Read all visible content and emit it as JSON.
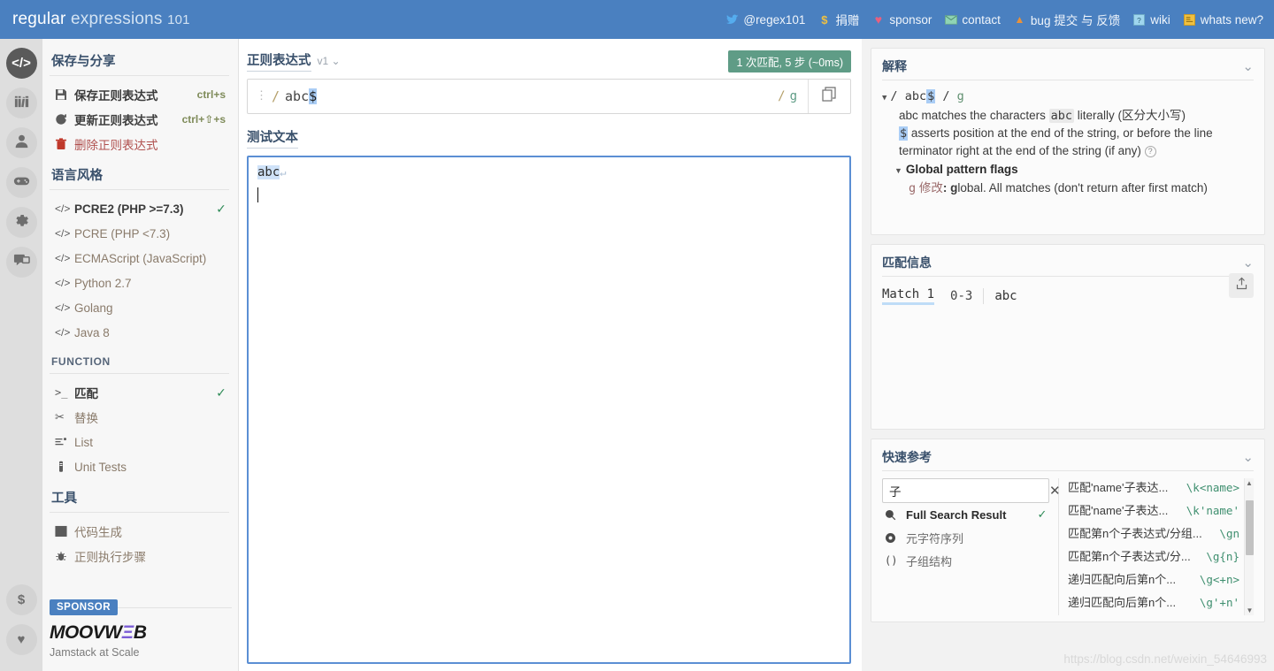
{
  "header": {
    "logo_regular": "regular ",
    "logo_expressions": "expressions ",
    "logo_101": "101",
    "nav": [
      {
        "icon": "twitter-icon",
        "glyph": "🐦",
        "label": "@regex101",
        "color": "#55acee"
      },
      {
        "icon": "dollar-icon",
        "glyph": "$",
        "label": "捐赠",
        "color": "#f0c040"
      },
      {
        "icon": "heart-icon",
        "glyph": "♥",
        "label": "sponsor",
        "color": "#e8607f"
      },
      {
        "icon": "envelope-icon",
        "glyph": "✉",
        "label": "contact",
        "color": "#7fc7a8"
      },
      {
        "icon": "warning-triangle-icon",
        "glyph": "▲",
        "label": "bug 提交 与 反馈",
        "color": "#e8913a"
      },
      {
        "icon": "wiki-icon",
        "glyph": "?",
        "label": "wiki",
        "color": "#7fc7e8"
      },
      {
        "icon": "news-page-icon",
        "glyph": "▤",
        "label": "whats new?",
        "color": "#f0c040"
      }
    ]
  },
  "rail": {
    "items": [
      {
        "name": "code-icon",
        "active": true
      },
      {
        "name": "library-icon",
        "active": false
      },
      {
        "name": "account-icon",
        "active": false
      },
      {
        "name": "gamepad-icon",
        "active": false
      },
      {
        "name": "gear-icon",
        "active": false
      },
      {
        "name": "chat-icon",
        "active": false
      }
    ],
    "bottom": [
      {
        "name": "dollar-icon",
        "glyph": "$"
      },
      {
        "name": "heart-icon",
        "glyph": "♥"
      }
    ]
  },
  "sidebar": {
    "save_share_title": "保存与分享",
    "save_share_items": [
      {
        "icon": "save-disk-icon",
        "label": "保存正则表达式",
        "shortcut": "ctrl+s"
      },
      {
        "icon": "refresh-icon",
        "label": "更新正则表达式",
        "shortcut": "ctrl+⇧+s"
      },
      {
        "icon": "trash-icon",
        "label": "删除正则表达式",
        "shortcut": ""
      }
    ],
    "flavor_title": "语言风格",
    "flavors": [
      {
        "label": "PCRE2 (PHP >=7.3)",
        "selected": true
      },
      {
        "label": "PCRE (PHP <7.3)",
        "selected": false
      },
      {
        "label": "ECMAScript (JavaScript)",
        "selected": false
      },
      {
        "label": "Python 2.7",
        "selected": false
      },
      {
        "label": "Golang",
        "selected": false
      },
      {
        "label": "Java 8",
        "selected": false
      }
    ],
    "function_title": "FUNCTION",
    "functions": [
      {
        "icon": "terminal-icon",
        "label": "匹配",
        "selected": true
      },
      {
        "icon": "scissors-icon",
        "label": "替换",
        "selected": false
      },
      {
        "icon": "list-icon",
        "label": "List",
        "selected": false
      },
      {
        "icon": "testtube-icon",
        "label": "Unit Tests",
        "selected": false
      }
    ],
    "tools_title": "工具",
    "tools": [
      {
        "icon": "code-gen-icon",
        "label": "代码生成"
      },
      {
        "icon": "debugger-bug-icon",
        "label": "正则执行步骤"
      }
    ],
    "sponsor_badge": "SPONSOR",
    "sponsor_name_a": "MOOVW",
    "sponsor_name_e": "Ξ",
    "sponsor_name_b": "B",
    "sponsor_tagline": "Jamstack at Scale"
  },
  "regex": {
    "title": "正则表达式",
    "version": "v1",
    "match_badge": "1 次匹配, 5 步 (~0ms)",
    "open_slash": "/",
    "pattern_literal": "abc",
    "pattern_selected": "$",
    "close_slash": "/",
    "flags": "g",
    "copy_icon": "copy-icon",
    "options_icon": "more-options-icon"
  },
  "test_string": {
    "title": "测试文本",
    "highlighted_text": "abc",
    "newline_glyph": "↵",
    "second_line": ""
  },
  "explanation": {
    "title": "解释",
    "root_slash_open": "/",
    "root_literal": "abc",
    "root_selected": "$",
    "root_slash_close": "/",
    "root_flags": "g",
    "line1_prefix": "abc",
    "line1_mid": " matches the characters ",
    "line1_code": "abc",
    "line1_suffix": " literally (区分大小写)",
    "line2_code": "$",
    "line2_text": " asserts position at the end of the string, or before the line terminator right at the end of the string (if any)",
    "flags_header": "Global pattern flags",
    "flag_letter": "g",
    "flag_label": "修改",
    "flag_colon": ":",
    "flag_bold": "g",
    "flag_desc": "lobal. All matches (don't return after first match)"
  },
  "match_info": {
    "title": "匹配信息",
    "match_label": "Match 1",
    "range": "0-3",
    "value": "abc",
    "export_icon": "export-share-icon"
  },
  "quick_reference": {
    "title": "快速参考",
    "search_value": "子",
    "search_placeholder": "",
    "clear_icon": "close-icon",
    "options": [
      {
        "icon": "search-icon",
        "label": "Full Search Result",
        "selected": true
      },
      {
        "icon": "meta-sequence-icon",
        "label": "元字符序列",
        "selected": false
      },
      {
        "icon": "group-paren-icon",
        "label": "子组结构",
        "selected": false
      }
    ],
    "results": [
      {
        "desc": "匹配'name'子表达...",
        "code": "\\k<name>"
      },
      {
        "desc": "匹配'name'子表达...",
        "code": "\\k'name'"
      },
      {
        "desc": "匹配第n个子表达式/分组...",
        "code": "\\gn"
      },
      {
        "desc": "匹配第n个子表达式/分...",
        "code": "\\g{n}"
      },
      {
        "desc": "递归匹配向后第n个...",
        "code": "\\g<+n>"
      },
      {
        "desc": "递归匹配向后第n个...",
        "code": "\\g'+n'"
      }
    ],
    "scroll_up": "▲",
    "scroll_down": "▼"
  },
  "watermark": "https://blog.csdn.net/weixin_54646993",
  "colors": {
    "header_blue": "#4a80c0",
    "match_green": "#5f9c86",
    "selection_blue": "#aacdf5",
    "highlight_blue": "#cfe2f8",
    "accent_border": "#5b8fd4",
    "danger_red": "#b0504e",
    "code_green": "#3f8f6f"
  }
}
